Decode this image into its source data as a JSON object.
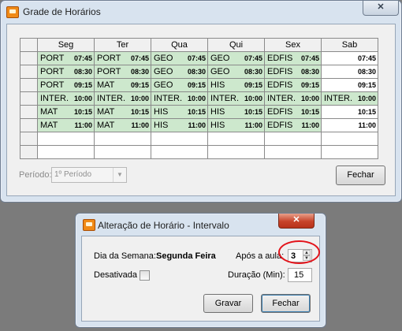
{
  "main_window": {
    "title": "Grade de Horários",
    "close_glyph": "✕",
    "columns": [
      "Seg",
      "Ter",
      "Qua",
      "Qui",
      "Sex",
      "Sab"
    ],
    "rows": [
      [
        [
          "PORT",
          "07:45"
        ],
        [
          "PORT",
          "07:45"
        ],
        [
          "GEO",
          "07:45"
        ],
        [
          "GEO",
          "07:45"
        ],
        [
          "EDFIS",
          "07:45"
        ],
        [
          "",
          "07:45"
        ]
      ],
      [
        [
          "PORT",
          "08:30"
        ],
        [
          "PORT",
          "08:30"
        ],
        [
          "GEO",
          "08:30"
        ],
        [
          "GEO",
          "08:30"
        ],
        [
          "EDFIS",
          "08:30"
        ],
        [
          "",
          "08:30"
        ]
      ],
      [
        [
          "PORT",
          "09:15"
        ],
        [
          "MAT",
          "09:15"
        ],
        [
          "GEO",
          "09:15"
        ],
        [
          "HIS",
          "09:15"
        ],
        [
          "EDFIS",
          "09:15"
        ],
        [
          "",
          "09:15"
        ]
      ],
      [
        [
          "INTER.",
          "10:00"
        ],
        [
          "INTER.",
          "10:00"
        ],
        [
          "INTER.",
          "10:00"
        ],
        [
          "INTER.",
          "10:00"
        ],
        [
          "INTER.",
          "10:00"
        ],
        [
          "INTER.",
          "10:00"
        ]
      ],
      [
        [
          "MAT",
          "10:15"
        ],
        [
          "MAT",
          "10:15"
        ],
        [
          "HIS",
          "10:15"
        ],
        [
          "HIS",
          "10:15"
        ],
        [
          "EDFIS",
          "10:15"
        ],
        [
          "",
          "10:15"
        ]
      ],
      [
        [
          "MAT",
          "11:00"
        ],
        [
          "MAT",
          "11:00"
        ],
        [
          "HIS",
          "11:00"
        ],
        [
          "HIS",
          "11:00"
        ],
        [
          "EDFIS",
          "11:00"
        ],
        [
          "",
          "11:00"
        ]
      ]
    ],
    "periodo_label": "Período:",
    "periodo_value": "1º Período",
    "fechar_label": "Fechar"
  },
  "dialog": {
    "title": "Alteração de Horário - Intervalo",
    "close_glyph": "✕",
    "dia_label": "Dia da Semana:",
    "dia_value": "Segunda Feira",
    "apos_label": "Após a aula:",
    "apos_value": "3",
    "desativada_label": "Desativada",
    "duracao_label": "Duração (Min):",
    "duracao_value": "15",
    "gravar_label": "Gravar",
    "fechar_label": "Fechar"
  },
  "colors": {
    "lesson_cell": "#cde8cd",
    "empty_cell": "#ffffff",
    "highlight_ring": "#e3141b"
  },
  "icons": [
    "app-icon",
    "close-icon",
    "dropdown-arrow-icon",
    "spinner-up-icon",
    "spinner-down-icon"
  ]
}
